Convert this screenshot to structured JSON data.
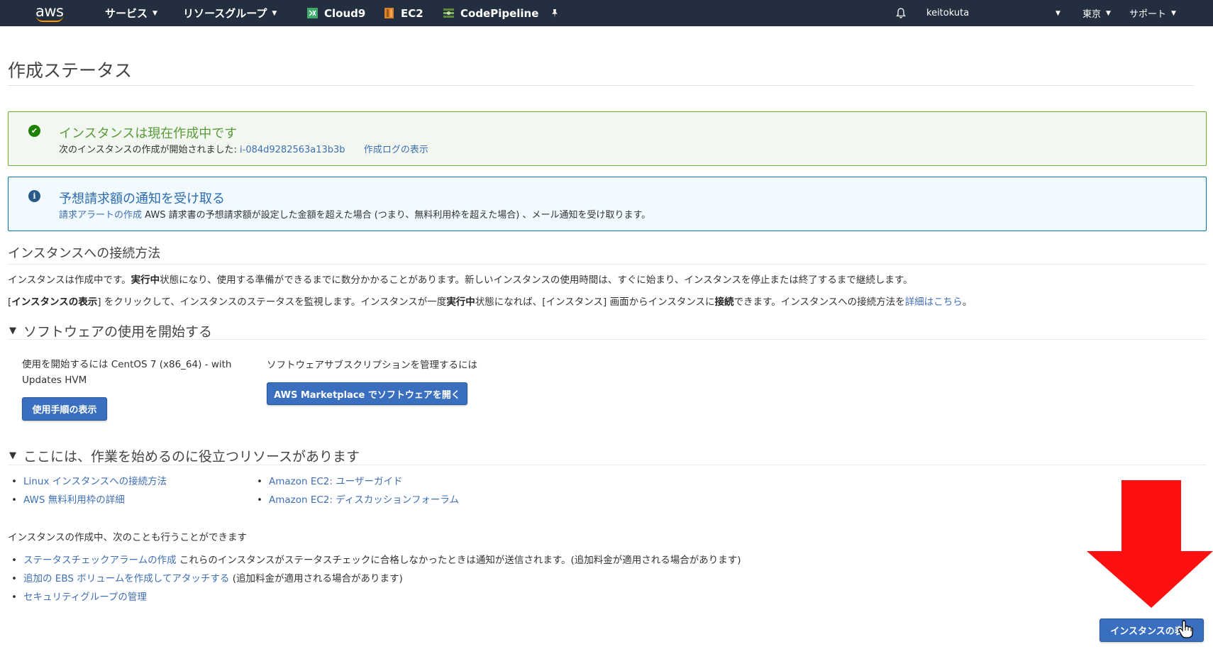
{
  "nav": {
    "logo": "aws",
    "services": "サービス",
    "resource_groups": "リソースグループ",
    "shortcuts": [
      "Cloud9",
      "EC2",
      "CodePipeline"
    ],
    "user": "keitokuta",
    "region": "東京",
    "support": "サポート",
    "colors": {
      "bg": "#232f3e",
      "accent": "#ff9900"
    }
  },
  "page": {
    "title": "作成ステータス"
  },
  "success_alert": {
    "heading": "インスタンスは現在作成中です",
    "text": "次のインスタンスの作成が開始されました:",
    "instance_id": "i-084d9282563a13b3b",
    "log_link": "作成ログの表示"
  },
  "info_alert": {
    "heading": "予想請求額の通知を受け取る",
    "link": "請求アラートの作成",
    "text": "AWS 請求書の予想請求額が設定した金額を超えた場合 (つまり、無料利用枠を超えた場合) 、メール通知を受け取ります。"
  },
  "connect": {
    "title": "インスタンスへの接続方法",
    "p1a": "インスタンスは作成中です。",
    "p1b": "実行中",
    "p1c": "状態になり、使用する準備ができるまでに数分かかることがあります。新しいインスタンスの使用時間は、すぐに始まり、インスタンスを停止または終了するまで継続します。",
    "p2a": "[",
    "p2b": "インスタンスの表示",
    "p2c": "] をクリックして、インスタンスのステータスを監視します。インスタンスが一度",
    "p2d": "実行中",
    "p2e": "状態になれば、[インスタンス] 画面からインスタンスに",
    "p2f": "接続",
    "p2g": "できます。インスタンスへの接続方法を",
    "p2link": "詳細はこちら",
    "p2h": "。"
  },
  "software": {
    "title": "ソフトウェアの使用を開始する",
    "start_text_line1": "使用を開始するには CentOS 7 (x86_64) - with",
    "start_text_line2": "Updates HVM",
    "usage_button": "使用手順の表示",
    "subscription_text": "ソフトウェアサブスクリプションを管理するには",
    "marketplace_button": "AWS Marketplace でソフトウェアを開く"
  },
  "resources": {
    "title": "ここには、作業を始めるのに役立つリソースがあります",
    "left": [
      "Linux インスタンスへの接続方法",
      "AWS 無料利用枠の詳細"
    ],
    "right": [
      "Amazon EC2: ユーザーガイド",
      "Amazon EC2: ディスカッションフォーラム"
    ]
  },
  "more": {
    "title": "インスタンスの作成中、次のことも行うことができます",
    "items": [
      {
        "link": "ステータスチェックアラームの作成",
        "text": " これらのインスタンスがステータスチェックに合格しなかったときは通知が送信されます。(追加料金が適用される場合があります)"
      },
      {
        "link": "追加の EBS ボリュームを作成してアタッチする",
        "text": " (追加料金が適用される場合があります)"
      },
      {
        "link": "セキュリティグループの管理",
        "text": ""
      }
    ]
  },
  "view_instances_button": "インスタンスの表示",
  "annotation": {
    "arrow_color": "#ff0000"
  }
}
